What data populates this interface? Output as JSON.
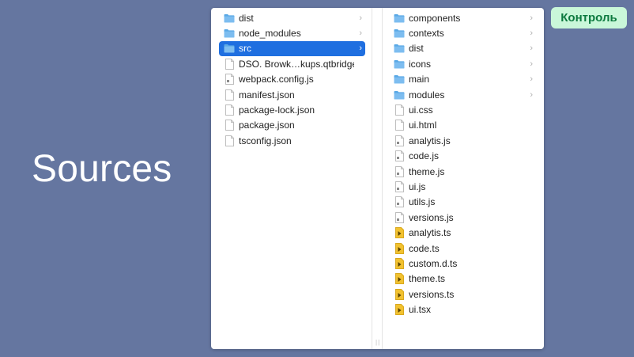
{
  "slide": {
    "title": "Sources",
    "badge": "Контроль"
  },
  "colors": {
    "background": "#6576a0",
    "badge_bg": "#c9f7d9",
    "badge_text": "#0d7a3f",
    "selection": "#1f6fe0",
    "folder": "#5aa9e6",
    "ts_file": "#f2c230"
  },
  "finder": {
    "column_1": [
      {
        "label": "dist",
        "icon": "folder-icon",
        "chevron": "›",
        "selected": false
      },
      {
        "label": "node_modules",
        "icon": "folder-icon",
        "chevron": "›",
        "selected": false
      },
      {
        "label": "src",
        "icon": "folder-icon",
        "chevron": "›",
        "selected": true
      },
      {
        "label": "DSO. Browk…kups.qtbridge",
        "icon": "file-icon",
        "chevron": "",
        "selected": false
      },
      {
        "label": "webpack.config.js",
        "icon": "js-file-icon",
        "chevron": "",
        "selected": false
      },
      {
        "label": "manifest.json",
        "icon": "file-icon",
        "chevron": "",
        "selected": false
      },
      {
        "label": "package-lock.json",
        "icon": "file-icon",
        "chevron": "",
        "selected": false
      },
      {
        "label": "package.json",
        "icon": "file-icon",
        "chevron": "",
        "selected": false
      },
      {
        "label": "tsconfig.json",
        "icon": "file-icon",
        "chevron": "",
        "selected": false
      }
    ],
    "column_2": [
      {
        "label": "components",
        "icon": "folder-icon",
        "chevron": "›"
      },
      {
        "label": "contexts",
        "icon": "folder-icon",
        "chevron": "›"
      },
      {
        "label": "dist",
        "icon": "folder-icon",
        "chevron": "›"
      },
      {
        "label": "icons",
        "icon": "folder-icon",
        "chevron": "›"
      },
      {
        "label": "main",
        "icon": "folder-icon",
        "chevron": "›"
      },
      {
        "label": "modules",
        "icon": "folder-icon",
        "chevron": "›"
      },
      {
        "label": "ui.css",
        "icon": "file-icon",
        "chevron": ""
      },
      {
        "label": "ui.html",
        "icon": "file-icon",
        "chevron": ""
      },
      {
        "label": "analytis.js",
        "icon": "js-file-icon",
        "chevron": ""
      },
      {
        "label": "code.js",
        "icon": "js-file-icon",
        "chevron": ""
      },
      {
        "label": "theme.js",
        "icon": "js-file-icon",
        "chevron": ""
      },
      {
        "label": "ui.js",
        "icon": "js-file-icon",
        "chevron": ""
      },
      {
        "label": "utils.js",
        "icon": "js-file-icon",
        "chevron": ""
      },
      {
        "label": "versions.js",
        "icon": "js-file-icon",
        "chevron": ""
      },
      {
        "label": "analytis.ts",
        "icon": "ts-file-icon",
        "chevron": ""
      },
      {
        "label": "code.ts",
        "icon": "ts-file-icon",
        "chevron": ""
      },
      {
        "label": "custom.d.ts",
        "icon": "ts-file-icon",
        "chevron": ""
      },
      {
        "label": "theme.ts",
        "icon": "ts-file-icon",
        "chevron": ""
      },
      {
        "label": "versions.ts",
        "icon": "ts-file-icon",
        "chevron": ""
      },
      {
        "label": "ui.tsx",
        "icon": "ts-file-icon",
        "chevron": ""
      }
    ]
  }
}
